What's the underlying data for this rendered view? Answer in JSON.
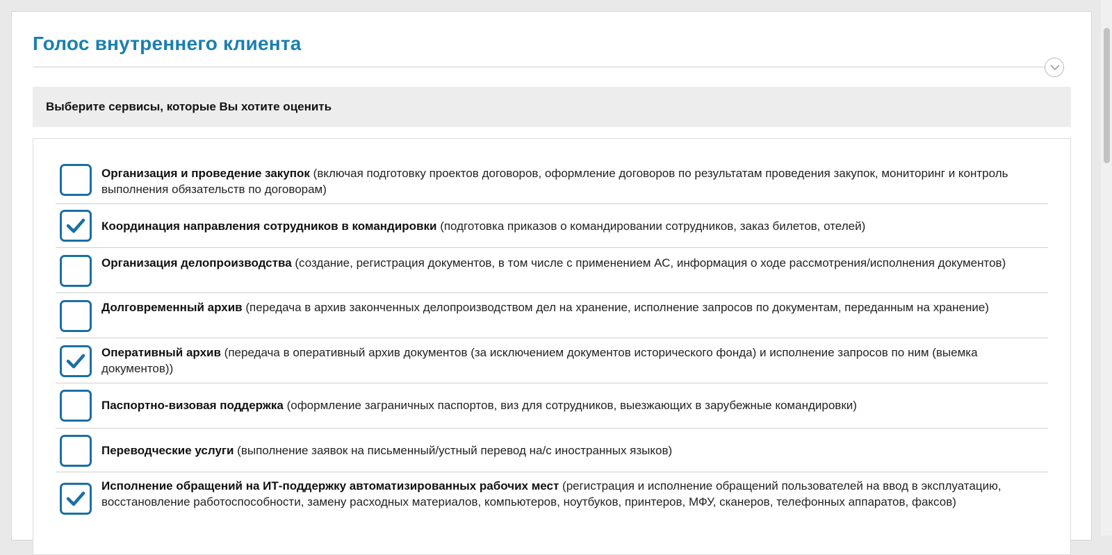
{
  "page": {
    "title": "Голос внутреннего клиента",
    "collapse_icon": "chevron-down-icon"
  },
  "section": {
    "header": "Выберите сервисы, которые Вы хотите оценить"
  },
  "services": [
    {
      "name": "Организация и проведение закупок",
      "description": " (включая подготовку проектов договоров, оформление договоров по результатам проведения закупок, мониторинг и контроль выполнения обязательств по договорам)",
      "checked": false
    },
    {
      "name": "Координация направления сотрудников в командировки",
      "description": " (подготовка приказов о командировании сотрудников, заказ билетов, отелей)",
      "checked": true
    },
    {
      "name": "Организация делопроизводства",
      "description": " (создание, регистрация документов, в том числе с применением АС, информация о ходе рассмотрения/исполнения документов)",
      "checked": false
    },
    {
      "name": "Долговременный архив",
      "description": " (передача в архив законченных делопроизводством дел на хранение, исполнение запросов по документам, переданным на хранение)",
      "checked": false
    },
    {
      "name": "Оперативный архив",
      "description": " (передача в оперативный архив документов (за исключением документов исторического фонда) и исполнение запросов по ним (выемка документов))",
      "checked": true
    },
    {
      "name": "Паспортно-визовая поддержка",
      "description": " (оформление заграничных паспортов, виз для сотрудников, выезжающих в зарубежные командировки)",
      "checked": false
    },
    {
      "name": "Переводческие услуги",
      "description": " (выполнение заявок на письменный/устный перевод на/с иностранных языков)",
      "checked": false
    },
    {
      "name": "Исполнение обращений на ИТ-поддержку автоматизированных рабочих мест",
      "description": " (регистрация и исполнение обращений пользователей на ввод в эксплуатацию, восстановление работоспособности, замену расходных материалов, компьютеров, ноутбуков, принтеров, МФУ, сканеров, телефонных аппаратов, факсов)",
      "checked": true
    }
  ],
  "colors": {
    "accent": "#1b7fb0",
    "checkbox_border": "#1a6fa5",
    "header_bg": "#ededed"
  }
}
